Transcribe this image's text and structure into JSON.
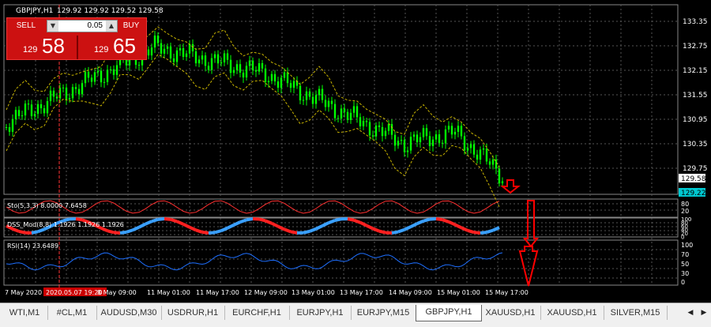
{
  "header": {
    "symbol_info": "GBPJPY,H1",
    "ohlc": "129.92 129.92 129.52 129.58"
  },
  "trade_panel": {
    "sell_label": "SELL",
    "buy_label": "BUY",
    "lot_value": "0.05",
    "sell_prefix": "129",
    "sell_big": "58",
    "buy_prefix": "129",
    "buy_big": "65"
  },
  "price_axis": {
    "labels": [
      "133.35",
      "132.75",
      "132.15",
      "131.55",
      "130.95",
      "130.35",
      "129.75"
    ],
    "current_price": "129.58",
    "current_price_alt": "129.22"
  },
  "indicators": {
    "stoch_label": "Sto(5,3,3) 8.0000 7.6458",
    "stoch_axis": [
      "80",
      "20"
    ],
    "dss_label": "DSS_Mod(8,8) 1.1926 1.1926 1.1926",
    "dss_axis": [
      "100",
      "80",
      "60",
      "40",
      "20",
      "0"
    ],
    "rsi_label": "RSI(14) 23.6489",
    "rsi_axis": [
      "100",
      "70",
      "50",
      "30",
      "0"
    ]
  },
  "time_axis": {
    "labels": [
      "7 May 2020",
      "2020.05.07 19:20",
      "8 May 09:00",
      "11 May 01:00",
      "11 May 17:00",
      "12 May 09:00",
      "13 May 01:00",
      "13 May 17:00",
      "14 May 09:00",
      "15 May 01:00",
      "15 May 17:00"
    ]
  },
  "tabs": [
    {
      "label": "WTI,M1",
      "active": false
    },
    {
      "label": "#CL,M1",
      "active": false
    },
    {
      "label": "AUDUSD,M30",
      "active": false
    },
    {
      "label": "USDRUR,H1",
      "active": false
    },
    {
      "label": "EURCHF,H1",
      "active": false
    },
    {
      "label": "EURJPY,H1",
      "active": false
    },
    {
      "label": "EURJPY,M15",
      "active": false
    },
    {
      "label": "GBPJPY,H1",
      "active": true
    },
    {
      "label": "XAUUSD,H1",
      "active": false
    },
    {
      "label": "XAUUSD,H1",
      "active": false
    },
    {
      "label": "SILVER,M15",
      "active": false
    }
  ],
  "colors": {
    "candle": "#00ff00",
    "bands": "#c8b400",
    "grid": "#555555",
    "stoch_main": "#ff3030",
    "dss_up": "#3aa0ff",
    "dss_down": "#ff2020",
    "rsi": "#1e6fff",
    "annotation_arrow": "#ff0000",
    "vertical_marker": "#ff3333"
  }
}
